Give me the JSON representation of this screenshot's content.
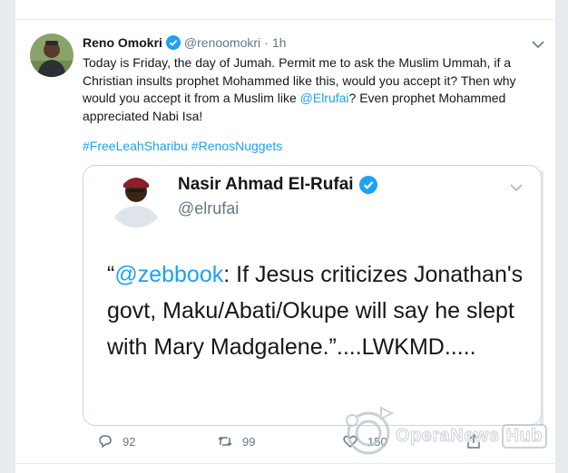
{
  "tweet": {
    "author_name": "Reno Omokri",
    "author_handle": "@renoomokri",
    "separator": "·",
    "time": "1h",
    "text_part1": "Today is Friday, the day of Jumah. Permit me to ask the Muslim Ummah, if a Christian insults prophet Mohammed like this, would you accept it? Then why would you accept it from a Muslim like ",
    "mention": "@Elrufai",
    "text_part2": "? Even prophet Mohammed appreciated Nabi Isa!",
    "hashtags": "#FreeLeahSharibu #RenosNuggets",
    "replies": "92",
    "retweets": "99",
    "likes": "150"
  },
  "quoted": {
    "author_name": "Nasir Ahmad El-Rufai",
    "author_handle": "@elrufai",
    "text_open": "“",
    "mention": "@zebbook",
    "text_body": ": If Jesus criticizes Jonathan's govt, Maku/Abati/Okupe will say he slept with Mary Madgalene.”....LWKMD....."
  },
  "watermark": {
    "text": "OperaNews",
    "hub": "Hub"
  },
  "colors": {
    "link": "#1da1f2",
    "verified": "#1da1f2",
    "muted": "#657786",
    "border": "#e6ecf0"
  }
}
